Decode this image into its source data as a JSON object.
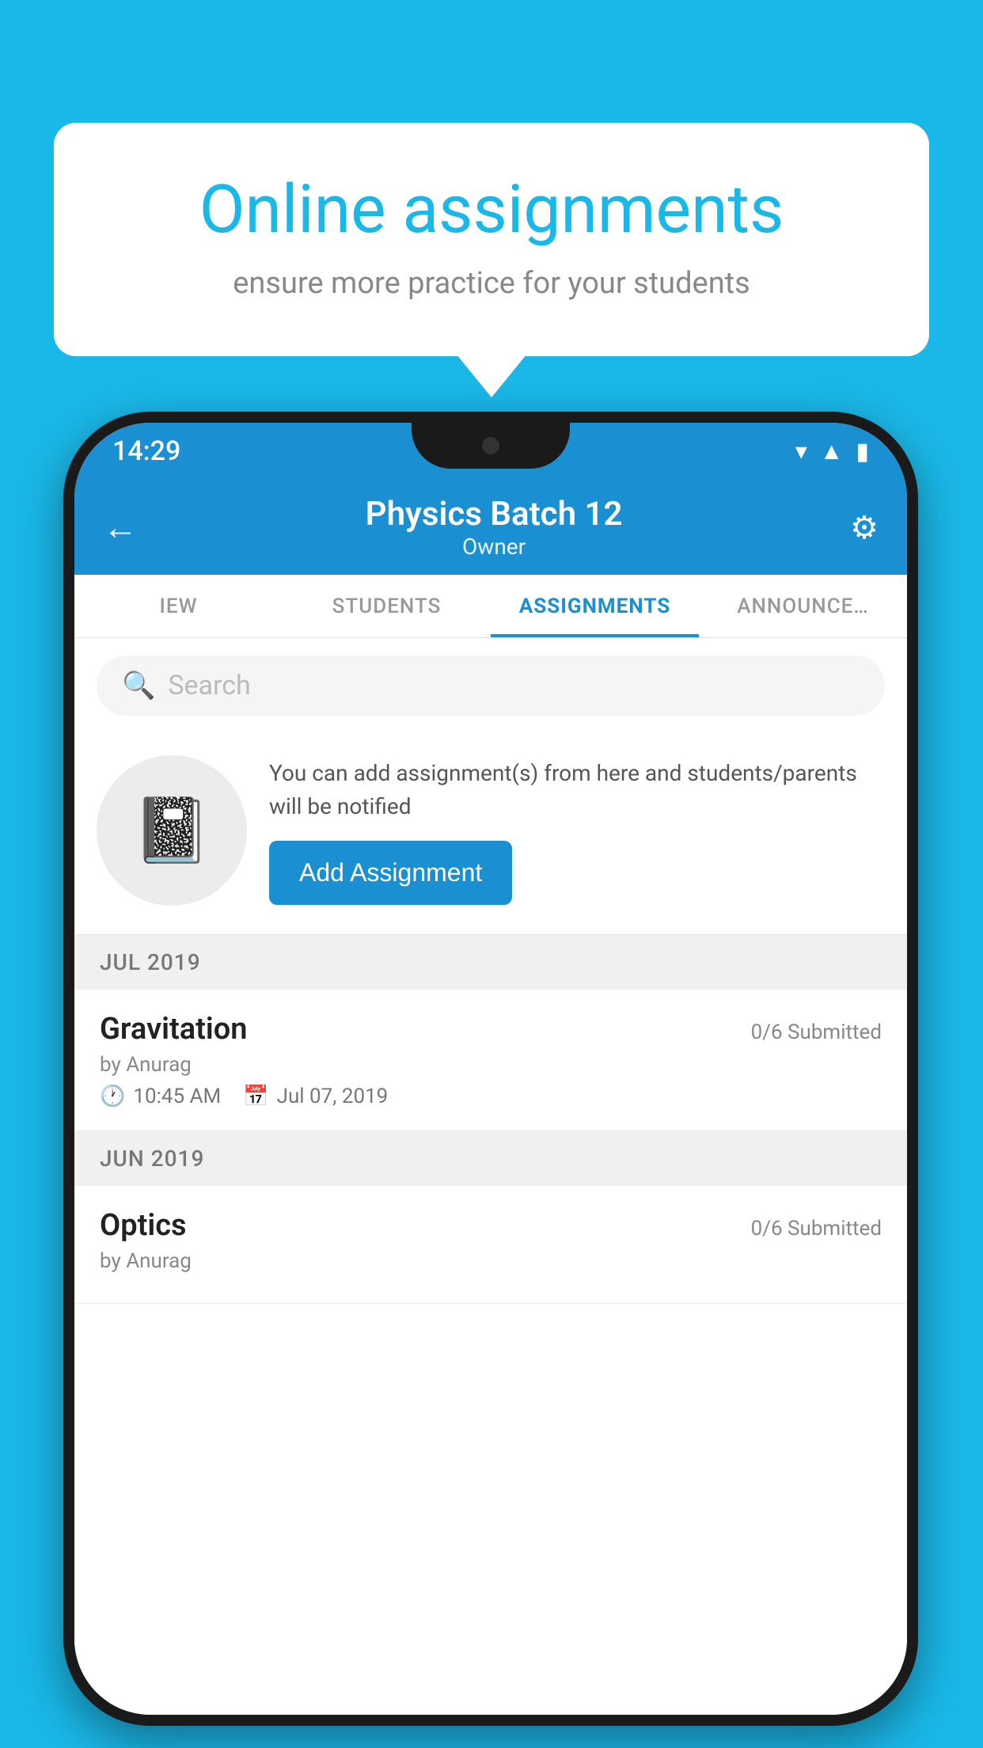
{
  "background_color": "#1ab8e8",
  "promo": {
    "title": "Online assignments",
    "subtitle": "ensure more practice for your students"
  },
  "phone": {
    "status_bar": {
      "time": "14:29",
      "wifi_icon": "wifi",
      "signal_icon": "signal",
      "battery_icon": "battery"
    },
    "header": {
      "title": "Physics Batch 12",
      "subtitle": "Owner",
      "back_label": "←",
      "settings_label": "⚙"
    },
    "tabs": [
      {
        "label": "IEW",
        "active": false
      },
      {
        "label": "STUDENTS",
        "active": false
      },
      {
        "label": "ASSIGNMENTS",
        "active": true
      },
      {
        "label": "ANNOUNCEMENTS",
        "active": false
      }
    ],
    "search": {
      "placeholder": "Search"
    },
    "add_assignment": {
      "info_text": "You can add assignment(s) from here and students/parents will be notified",
      "button_label": "Add Assignment"
    },
    "assignment_groups": [
      {
        "month_label": "JUL 2019",
        "assignments": [
          {
            "name": "Gravitation",
            "submitted": "0/6 Submitted",
            "by": "by Anurag",
            "time": "10:45 AM",
            "date": "Jul 07, 2019"
          }
        ]
      },
      {
        "month_label": "JUN 2019",
        "assignments": [
          {
            "name": "Optics",
            "submitted": "0/6 Submitted",
            "by": "by Anurag",
            "time": "",
            "date": ""
          }
        ]
      }
    ]
  }
}
